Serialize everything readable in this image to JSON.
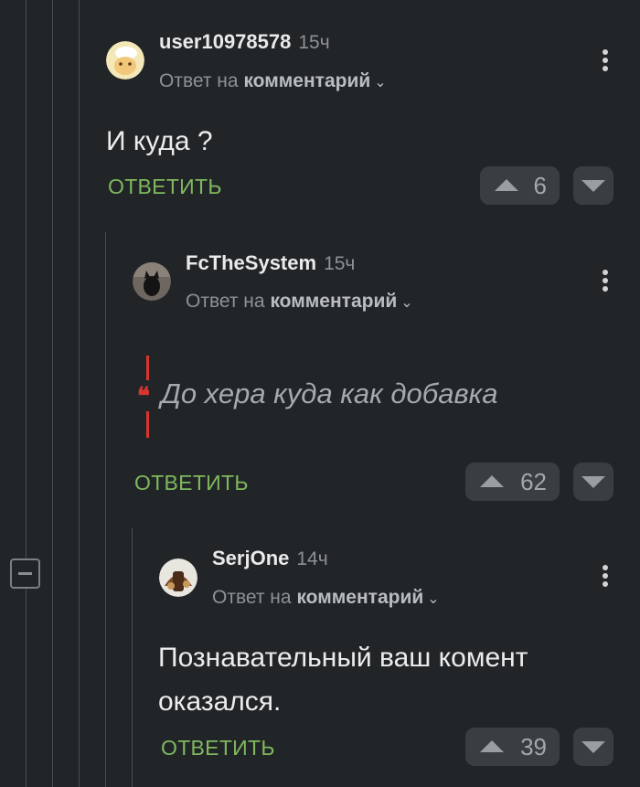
{
  "comments": [
    {
      "author": "user10978578",
      "time": "15ч",
      "reply_prefix": "Ответ на",
      "reply_target": "комментарий",
      "text": "И куда ?",
      "reply_label": "ОТВЕТИТЬ",
      "rating": "6"
    },
    {
      "author": "FcTheSystem",
      "time": "15ч",
      "reply_prefix": "Ответ на",
      "reply_target": "комментарий",
      "quote_mark": "❝",
      "quote": "До хера куда как добавка",
      "reply_label": "ОТВЕТИТЬ",
      "rating": "62"
    },
    {
      "author": "SerjOne",
      "time": "14ч",
      "reply_prefix": "Ответ на",
      "reply_target": "комментарий",
      "text_line1": "Познавательный ваш комент",
      "text_line2": "оказался.",
      "reply_label": "ОТВЕТИТЬ",
      "rating": "39"
    }
  ],
  "colors": {
    "background": "#222528",
    "accent_reply": "#7fb85e",
    "quote_bar": "#d8352f",
    "vote_bg": "#3a3d41"
  },
  "icons": [
    "collapse-thread-icon",
    "more-vertical-icon",
    "chevron-down-icon",
    "upvote-icon",
    "downvote-icon",
    "quote-icon"
  ]
}
